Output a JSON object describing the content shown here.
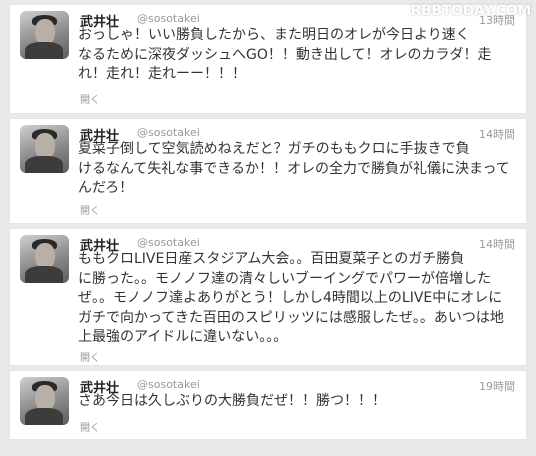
{
  "watermark": "RBBTODAY.COM",
  "tweets": [
    {
      "name": "武井壮",
      "handle": "@sosotakei",
      "time": "13時間",
      "text": "おっしゃ！いい勝負したから、また明日のオレが今日より速く\nなるために深夜ダッシュへGO！！動き出して！オレのカラダ！走\nれ！走れ！走れーー！！！",
      "expand": "開く"
    },
    {
      "name": "武井壮",
      "handle": "@sosotakei",
      "time": "14時間",
      "text": "夏菜子倒して空気読めねえだと？ガチのももクロに手抜きで負\nけるなんて失礼な事できるか！！オレの全力で勝負が礼儀に決まって\nんだろ！",
      "expand": "開く"
    },
    {
      "name": "武井壮",
      "handle": "@sosotakei",
      "time": "14時間",
      "text": "ももクロLIVE日産スタジアム大会。。百田夏菜子とのガチ勝負\nに勝った。。モノノフ達の清々しいブーイングでパワーが倍増した\nぜ。。モノノフ達よありがとう！しかし4時間以上のLIVE中にオレに\nガチで向かってきた百田のスピリッツには感服したぜ。。あいつは地\n上最強のアイドルに違いない。。。",
      "expand": "開く"
    },
    {
      "name": "武井壮",
      "handle": "@sosotakei",
      "time": "19時間",
      "text": "さあ今日は久しぶりの大勝負だぜ！！勝つ！！！",
      "expand": "開く"
    }
  ]
}
